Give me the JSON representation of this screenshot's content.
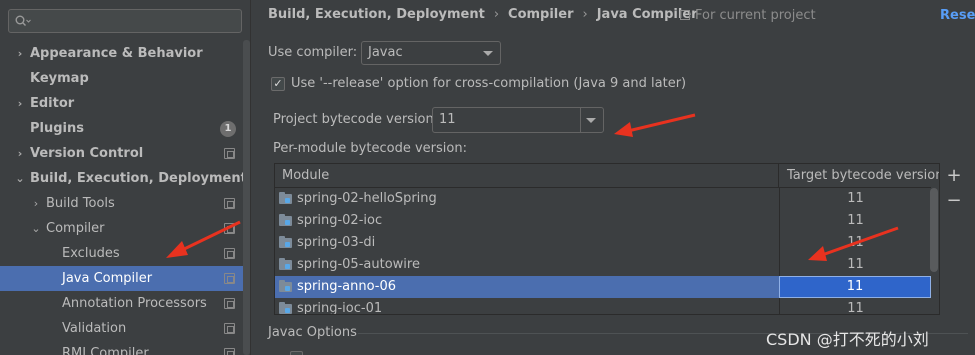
{
  "sidebar": {
    "search": {
      "placeholder": "",
      "icon": "search-icon"
    },
    "items": [
      {
        "label": "Appearance & Behavior",
        "arrow": "›"
      },
      {
        "label": "Keymap"
      },
      {
        "label": "Editor",
        "arrow": "›"
      },
      {
        "label": "Plugins",
        "badge": "1"
      },
      {
        "label": "Version Control",
        "arrow": "›"
      },
      {
        "label": "Build, Execution, Deployment",
        "arrow": "⌄"
      },
      {
        "label": "Build Tools",
        "arrow": "›"
      },
      {
        "label": "Compiler",
        "arrow": "⌄"
      },
      {
        "label": "Excludes"
      },
      {
        "label": "Java Compiler"
      },
      {
        "label": "Annotation Processors"
      },
      {
        "label": "Validation"
      },
      {
        "label": "RMI Compiler"
      }
    ]
  },
  "header": {
    "breadcrumb": [
      "Build, Execution, Deployment",
      "Compiler",
      "Java Compiler"
    ],
    "separator": "›",
    "scope_note": "For current project",
    "reset_label": "Reset"
  },
  "form": {
    "use_compiler_label": "Use compiler:",
    "use_compiler_value": "Javac",
    "release_option_label": "Use '--release' option for cross-compilation (Java 9 and later)",
    "release_option_checked": true,
    "check_mark": "✓",
    "project_bytecode_label": "Project bytecode version:",
    "project_bytecode_value": "11",
    "per_module_label": "Per-module bytecode version:"
  },
  "table": {
    "columns": [
      "Module",
      "Target bytecode version"
    ],
    "rows": [
      {
        "module": "spring-02-helloSpring",
        "version": "11"
      },
      {
        "module": "spring-02-ioc",
        "version": "11"
      },
      {
        "module": "spring-03-di",
        "version": "11"
      },
      {
        "module": "spring-05-autowire",
        "version": "11"
      },
      {
        "module": "spring-anno-06",
        "version": "11"
      },
      {
        "module": "spring-ioc-01",
        "version": "11"
      }
    ],
    "selected_row": "spring-anno-06",
    "add_label": "+",
    "remove_label": "−"
  },
  "bottom": {
    "javac_options_label": "Javac Options"
  },
  "watermark": "CSDN @打不死的小刘",
  "colors": {
    "background": "#3c3f41",
    "selection": "#4b6eaf",
    "link": "#589df6",
    "annotation_arrow": "#e8321f"
  }
}
